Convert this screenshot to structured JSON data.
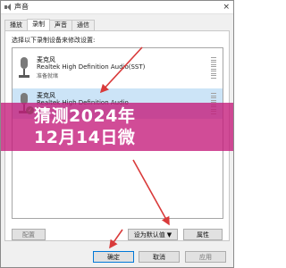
{
  "window": {
    "title": "声音",
    "close": "×"
  },
  "tabs": [
    {
      "label": "播放",
      "active": false
    },
    {
      "label": "录制",
      "active": true
    },
    {
      "label": "声音",
      "active": false
    },
    {
      "label": "通信",
      "active": false
    }
  ],
  "panel": {
    "instruction": "选择以下录制设备来修改设置:"
  },
  "devices": [
    {
      "name": "麦克风",
      "description": "Realtek High Definition Audio(SST)",
      "status": "准备就绪",
      "selected": false
    },
    {
      "name": "麦克风",
      "description": "Realtek High Definition Audio",
      "status": "",
      "selected": true
    }
  ],
  "buttons": {
    "configure": "配置",
    "set_default": "设为默认值",
    "dropdown_glyph": "▼",
    "properties": "属性",
    "ok": "确定",
    "cancel": "取消",
    "apply": "应用"
  },
  "overlay": {
    "line1": "猜测2024年",
    "line2": "12月14日微"
  },
  "colors": {
    "banner": "#c4197a",
    "annotation_arrow": "#d93a3a",
    "selection": "#cce4f7"
  }
}
